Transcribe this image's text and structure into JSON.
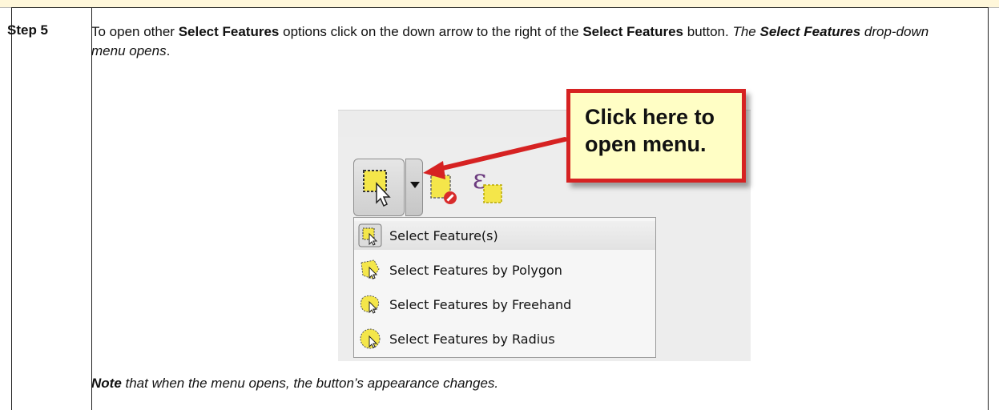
{
  "step": {
    "label": "Step 5",
    "text_p1": "To open other ",
    "text_b1": "Select Features",
    "text_p2": " options click on the down arrow to the right of the ",
    "text_b2": "Select Features",
    "text_p3": " button. ",
    "text_i1": "The ",
    "text_bi1": "Select Features",
    "text_i2": " drop-down menu opens",
    "text_p4": "."
  },
  "figure": {
    "callout_line1": "Click here to",
    "callout_line2": "open menu.",
    "menu_items": [
      {
        "label": "Select Feature(s)",
        "icon": "select-feature-icon"
      },
      {
        "label": "Select Features by Polygon",
        "icon": "select-polygon-icon"
      },
      {
        "label": "Select Features by Freehand",
        "icon": "select-freehand-icon"
      },
      {
        "label": "Select Features by Radius",
        "icon": "select-radius-icon"
      }
    ],
    "colors": {
      "callout_border": "#d62222",
      "callout_fill": "#fffec5",
      "arrow": "#d62222",
      "selection_yellow": "#f4e64a"
    }
  },
  "note": {
    "bold": "Note",
    "rest": " that when the menu opens, the button’s appearance changes."
  }
}
